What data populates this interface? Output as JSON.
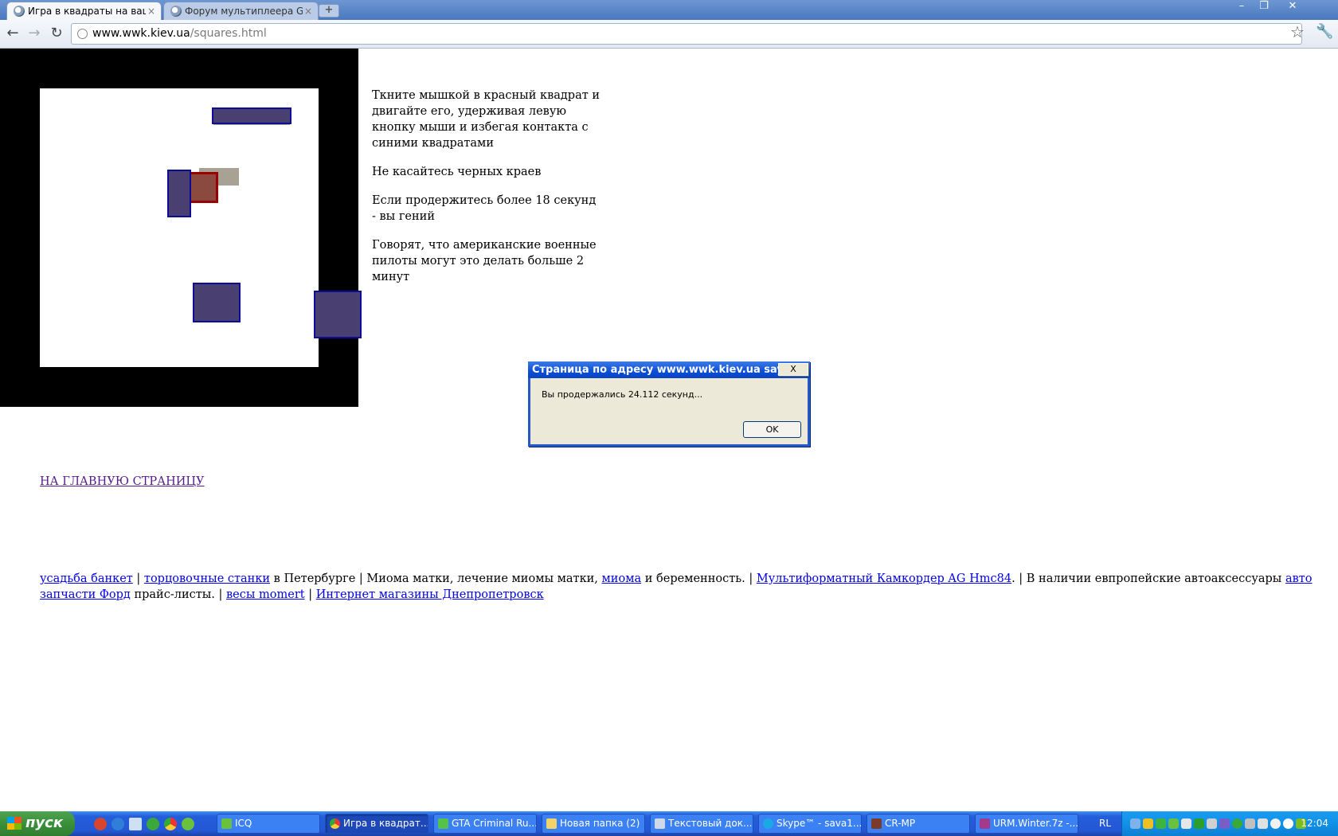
{
  "browser": {
    "tabs": [
      {
        "label": "Игра в квадраты на вашу ре",
        "active": true
      },
      {
        "label": "Форум мультиплеера GTA Кр",
        "active": false
      }
    ],
    "tab_close_glyph": "×",
    "new_tab_glyph": "+",
    "url_host": "www.wwk.kiev.ua",
    "url_path": "/squares.html",
    "window_controls": {
      "minimize": "–",
      "restore": "❐",
      "close": "✕"
    },
    "nav": {
      "back": "←",
      "forward": "→",
      "reload": "↻"
    },
    "bookmark_icon": "☆",
    "wrench_icon": "🔧"
  },
  "page": {
    "instructions": [
      "Ткните мышкой в красный квадрат и двигайте его, удерживая левую кнопку мыши и избегая контакта с синими квадратами",
      "Не касайтесь черных краев",
      "Если продержитесь более 18 секунд - вы гений",
      "Говорят, что американские военные пилоты могут это делать больше 2 минут"
    ],
    "home_link": "НА ГЛАВНУЮ СТРАНИЦУ",
    "ads": {
      "link_1": "усадьба банкет",
      "sep_1": " | ",
      "link_2": "торцовочные станки",
      "text_2": " в Петербурге | Миома матки, лечение миомы матки, ",
      "link_3": "миома",
      "text_3": " и беременность. | ",
      "link_4": "Мультиформатный Камкордер AG Hmc84",
      "text_4": ". | В наличии евпропейские автоаксессуары ",
      "link_5": "авто запчасти Форд",
      "text_5": " прайс-листы. | ",
      "link_6": "весы momert",
      "sep_6": " | ",
      "link_7": "Интернет магазины Днепропетровск"
    },
    "colors": {
      "blue_square": "#494071",
      "red_square": "#9a0000",
      "border": "#000000"
    }
  },
  "dialog": {
    "title": "Страница по адресу www.wwk.kiev.ua says:",
    "message": "Вы продержались 24.112 секунд...",
    "ok_label": "OK",
    "close_label": "X"
  },
  "taskbar": {
    "start_label": "пуск",
    "tasks": [
      {
        "label": "ICQ",
        "icon_color": "#6ac13c",
        "active": false
      },
      {
        "label": "Игра в квадрат...",
        "icon_color": "#e0b030",
        "active": true
      },
      {
        "label": "GTA Criminal Ru...",
        "icon_color": "#56c24a",
        "active": false
      },
      {
        "label": "Новая папка (2)",
        "icon_color": "#f2d36b",
        "active": false
      },
      {
        "label": "Текстовый док...",
        "icon_color": "#cfd8e8",
        "active": false
      },
      {
        "label": "Skype™ - sava1...",
        "icon_color": "#19a9e5",
        "active": false
      },
      {
        "label": "CR-MP",
        "icon_color": "#7a3b2a",
        "active": false
      },
      {
        "label": "URM.Winter.7z -...",
        "icon_color": "#a33a8c",
        "active": false
      }
    ],
    "language": "RL",
    "clock": "12:04"
  }
}
